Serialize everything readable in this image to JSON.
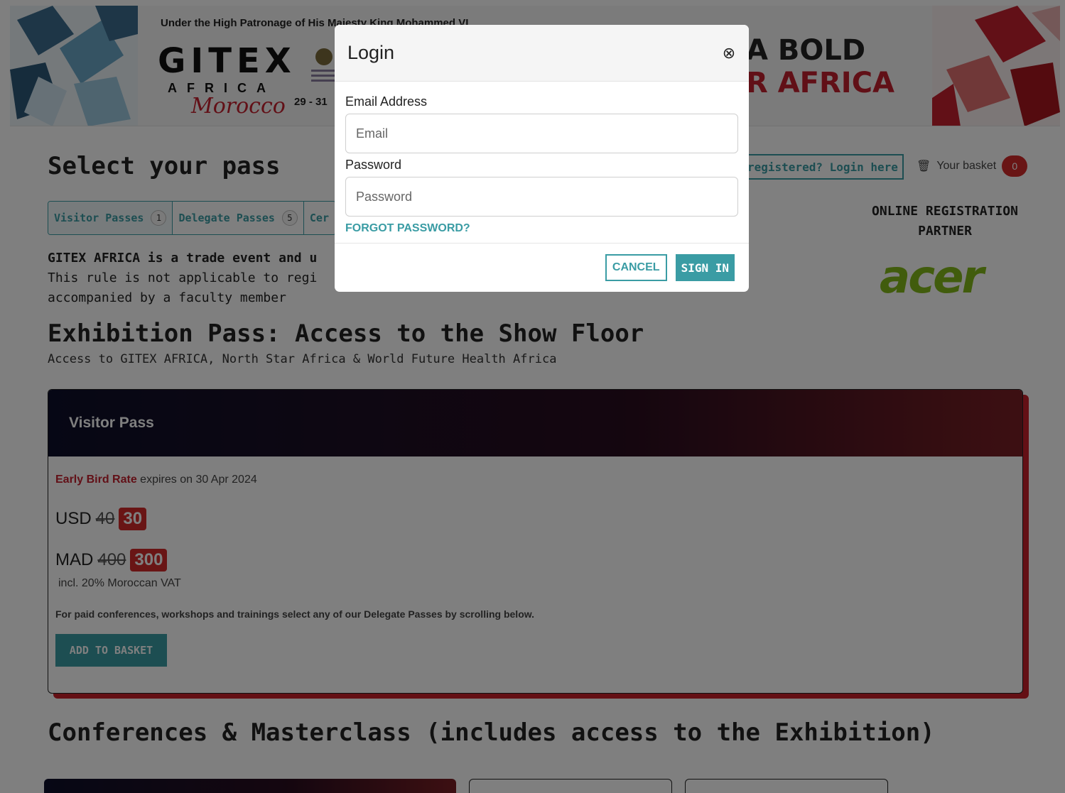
{
  "banner": {
    "patronage": "Under the High Patronage of His Majesty King Mohammed VI",
    "logo_word": "GITEX",
    "logo_region": "AFRICA",
    "logo_country": "Morocco",
    "dates": "29 - 31",
    "slogan_line1": "A BOLD",
    "slogan_line2": "R AFRICA"
  },
  "header": {
    "title": "Select your pass",
    "login_link": "registered? Login here",
    "basket_label": "Your basket",
    "basket_count": "0"
  },
  "tabs": [
    {
      "label": "Visitor Passes",
      "count": "1"
    },
    {
      "label": "Delegate Passes",
      "count": "5"
    },
    {
      "label": "Cer",
      "count": ""
    }
  ],
  "partner": {
    "label": "ONLINE REGISTRATION PARTNER",
    "logo": "acer"
  },
  "rules": {
    "line1_bold": "GITEX AFRICA is a trade event and u",
    "line2": "This rule is not applicable to regi",
    "line3": "accompanied by a faculty member"
  },
  "exhibition": {
    "title": "Exhibition Pass: Access to the Show Floor",
    "subtitle": "Access to GITEX AFRICA, North Star Africa & World Future Health Africa"
  },
  "visitor_pass": {
    "name": "Visitor Pass",
    "early_rate": "Early Bird Rate",
    "expires": "expires on 30 Apr 2024",
    "usd_currency": "USD",
    "usd_old": "40",
    "usd_new": "30",
    "mad_currency": "MAD",
    "mad_old": "400",
    "mad_new": "300",
    "vat": "incl. 20% Moroccan VAT",
    "note": "For paid conferences, workshops and trainings select any of our Delegate Passes by scrolling below.",
    "button": "ADD TO BASKET"
  },
  "conferences": {
    "title": "Conferences & Masterclass (includes access to the Exhibition)"
  },
  "modal": {
    "title": "Login",
    "email_label": "Email Address",
    "email_placeholder": "Email",
    "password_label": "Password",
    "password_placeholder": "Password",
    "forgot": "FORGOT PASSWORD?",
    "cancel": "CANCEL",
    "sign_in": "SIGN IN",
    "close_icon": "close-circle-icon"
  },
  "colors": {
    "accent": "#3a9ca4",
    "brand_red": "#c4212e",
    "acer_green": "#83b81a"
  }
}
